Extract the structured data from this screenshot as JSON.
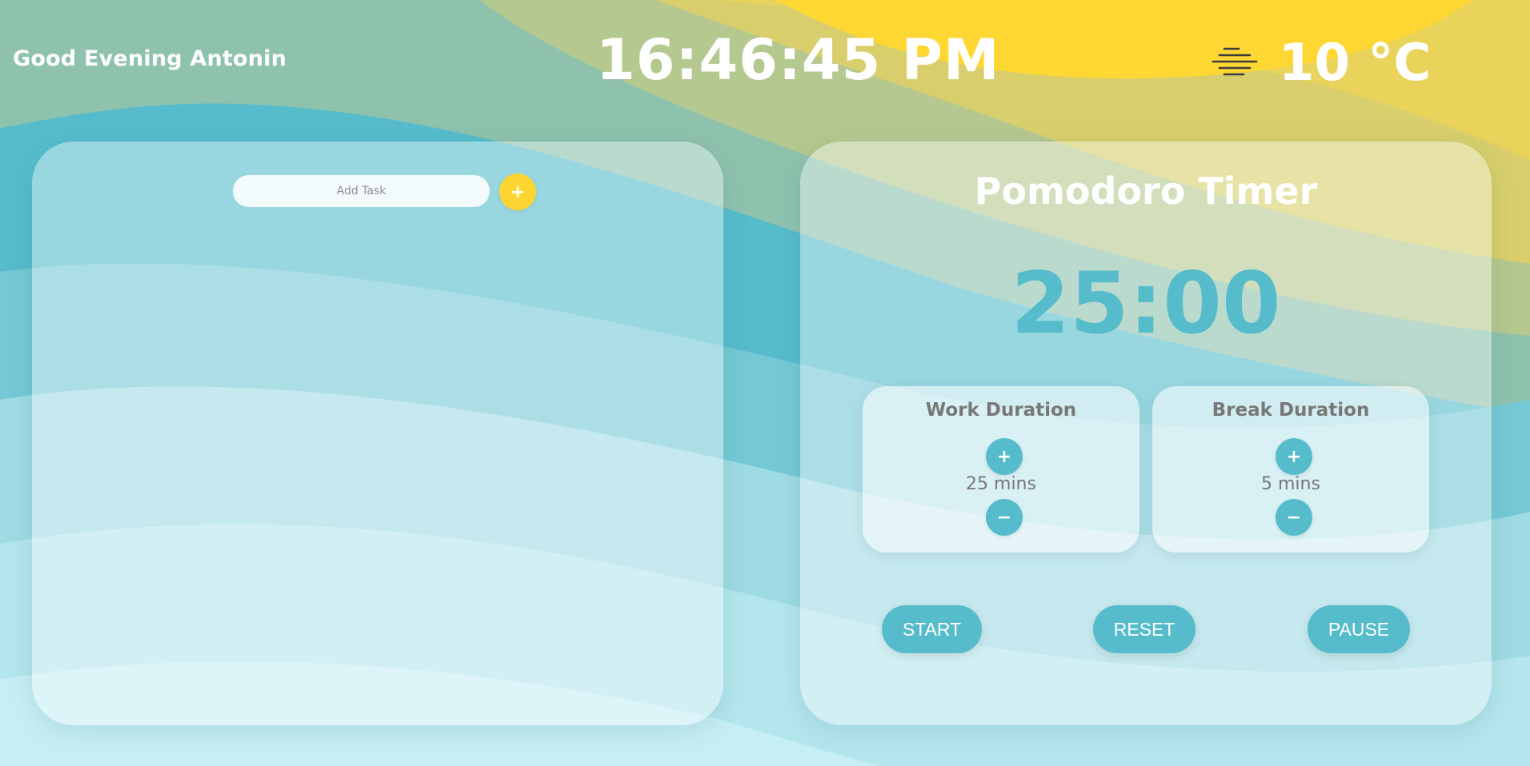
{
  "header": {
    "greeting": "Good Evening Antonin",
    "clock": "16:46:45 PM",
    "weather_icon": "fog-icon",
    "temperature": "10 °C"
  },
  "tasks": {
    "add_placeholder": "Add Task",
    "add_button_label": "+"
  },
  "pomodoro": {
    "title": "Pomodoro Timer",
    "time": "25:00",
    "work": {
      "title": "Work Duration",
      "value": "25 mins",
      "plus_label": "+",
      "minus_label": "−"
    },
    "break": {
      "title": "Break Duration",
      "value": "5 mins",
      "plus_label": "+",
      "minus_label": "−"
    },
    "buttons": {
      "start": "START",
      "reset": "RESET",
      "pause": "PAUSE"
    }
  },
  "colors": {
    "accent_teal": "#56bccb",
    "accent_yellow": "#fdd530",
    "text_gray": "#777777"
  }
}
